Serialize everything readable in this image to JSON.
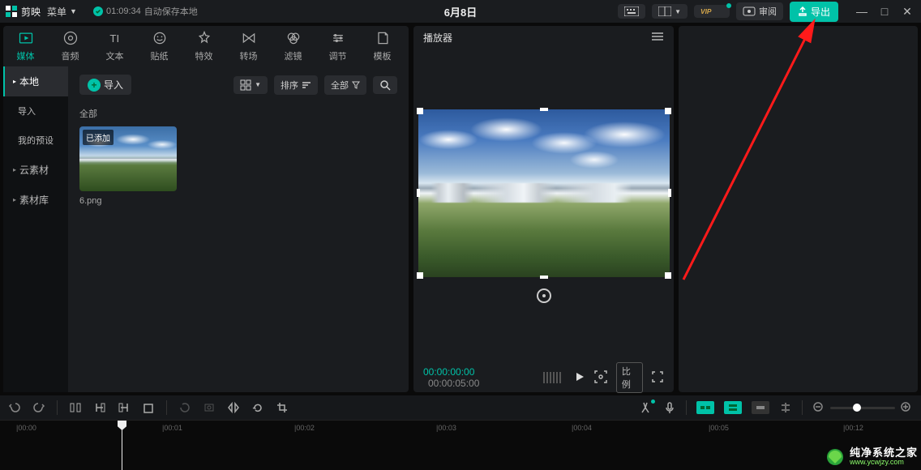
{
  "topbar": {
    "app": "剪映",
    "menu": "菜单",
    "autosave_time": "01:09:34",
    "autosave_text": "自动保存本地",
    "date": "6月8日",
    "vip": "VIP",
    "review": "审阅",
    "export": "导出"
  },
  "ribbon": [
    {
      "label": "媒体"
    },
    {
      "label": "音频"
    },
    {
      "label": "文本"
    },
    {
      "label": "贴纸"
    },
    {
      "label": "特效"
    },
    {
      "label": "转场"
    },
    {
      "label": "滤镜"
    },
    {
      "label": "调节"
    },
    {
      "label": "模板"
    }
  ],
  "sidebar": {
    "local": "本地",
    "import": "导入",
    "presets": "我的预设",
    "cloud": "云素材",
    "library": "素材库"
  },
  "assets": {
    "import_btn": "导入",
    "sort": "排序",
    "all": "全部",
    "section": "全部",
    "thumb_badge": "已添加",
    "thumb_name": "6.png"
  },
  "player": {
    "title": "播放器",
    "current": "00:00:00:00",
    "duration": "00:00:05:00",
    "ratio": "比例"
  },
  "ruler": {
    "t0": "|00:00",
    "t1": "|00:01",
    "t2": "|00:02",
    "t3": "|00:03",
    "t4": "|00:04",
    "t5": "|00:05",
    "t12": "|00:12"
  },
  "watermark": {
    "title": "纯净系统之家",
    "url": "www.ycwjzy.com"
  }
}
